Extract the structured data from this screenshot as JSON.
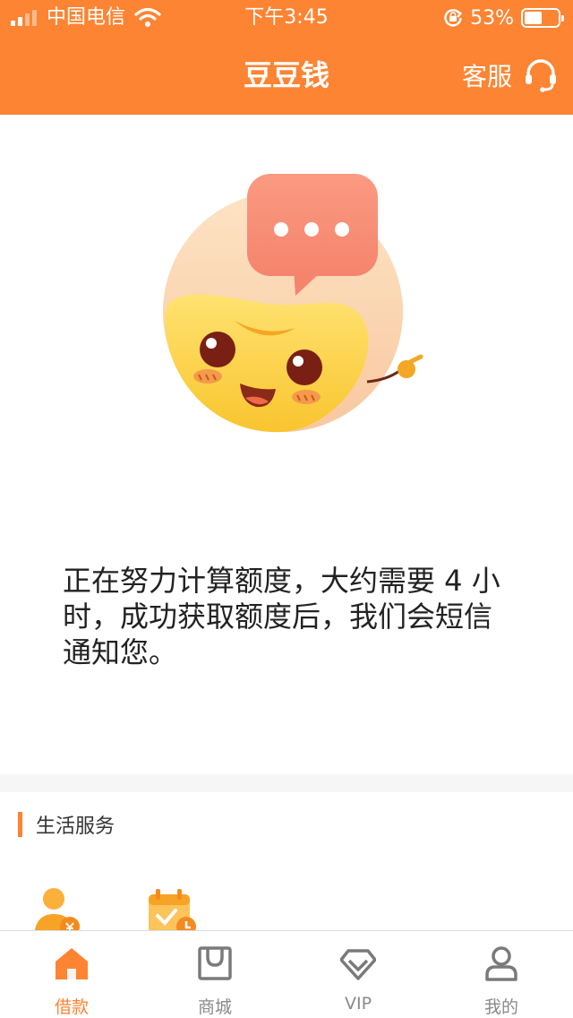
{
  "status_bar": {
    "carrier": "中国电信",
    "time": "下午3:45",
    "battery_percent": "53%",
    "battery_level": 0.53
  },
  "nav": {
    "title": "豆豆钱",
    "customer_service_label": "客服"
  },
  "message": {
    "text": "正在努力计算额度，大约需要 4 小时，成功获取额度后，我们会短信通知您。"
  },
  "services": {
    "title": "生活服务",
    "items": [
      {
        "icon": "person-money-icon"
      },
      {
        "icon": "calendar-check-icon"
      }
    ]
  },
  "tab_bar": {
    "tabs": [
      {
        "label": "借款",
        "icon": "home-icon",
        "active": true
      },
      {
        "label": "商城",
        "icon": "shopping-bag-icon",
        "active": false
      },
      {
        "label": "VIP",
        "icon": "diamond-icon",
        "active": false
      },
      {
        "label": "我的",
        "icon": "profile-icon",
        "active": false
      }
    ]
  },
  "colors": {
    "brand": "#fd8432",
    "inactive": "#8a8a8a"
  }
}
